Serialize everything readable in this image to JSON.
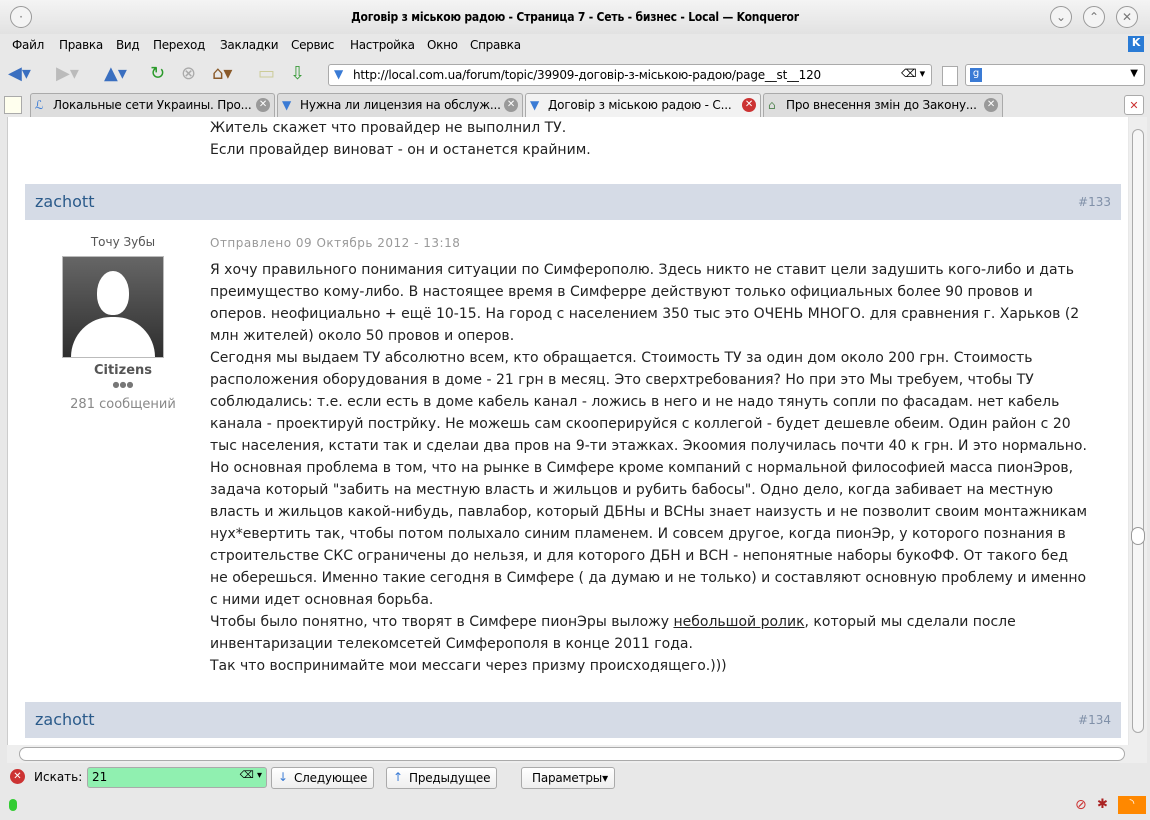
{
  "window": {
    "title": "Договір з міською радою - Страница 7 - Сеть - бизнес - Local — Konqueror"
  },
  "menu": [
    "Файл",
    "Правка",
    "Вид",
    "Переход",
    "Закладки",
    "Сервис",
    "Настройка",
    "Окно",
    "Справка"
  ],
  "url": "http://local.com.ua/forum/topic/39909-договір-з-міською-радою/page__st__120",
  "tabs": [
    {
      "label": "Локальные сети Украины. Про..."
    },
    {
      "label": "Нужна ли лицензия на обслуж..."
    },
    {
      "label": "Договір з міською радою - С..."
    },
    {
      "label": "Про внесення змін до Закону..."
    }
  ],
  "prev_post": {
    "lines": [
      "Житель скажет что провайдер не выполнил ТУ.",
      "Если провайдер виноват - он и останется крайним."
    ]
  },
  "post": {
    "author": "zachott",
    "number": "#133",
    "user_title": "Точу Зубы",
    "group": "Citizens",
    "pips": "●●●",
    "post_count": "281 сообщений",
    "date": "Отправлено 09 Октябрь 2012 - 13:18",
    "lines": [
      "Я хочу правильного понимания ситуации по Симферополю. Здесь никто не ставит цели задушить кого-либо и дать",
      "преимущество кому-либо. В настоящее время в Симферре действуют только официальных более 90 провов и",
      "оперов. неофициально + ещё 10-15. На город с населением 350 тыс это ОЧЕНЬ МНОГО. для сравнения г. Харьков (2",
      "млн жителей) около 50 провов и оперов.",
      "Сегодня мы выдаем ТУ абсолютно всем, кто обращается. Стоимость ТУ за один дом около 200 грн. Стоимость",
      "расположения оборудования в доме - 21 грн в месяц. Это сверхтребования? Но при это Мы требуем, чтобы ТУ",
      "соблюдались: т.е. если есть в доме кабель канал - ложись в него и не надо тянуть сопли по фасадам. нет кабель",
      "канала - проектируй пострйку. Не можешь сам скооперируйся с коллегой - будет дешевле обеим. Один район с 20",
      "тыс населения, кстати так и сделаи два пров на 9-ти этажках. Экоомия получилась почти 40 к грн. И это нормально.",
      "Но основная проблема в том, что на рынке в Симфере кроме компаний с нормальной философией масса пионЭров,",
      "задача который \"забить на местную власть и жильцов и рубить бабосы\". Одно дело, когда забивает на местную",
      "власть и жильцов какой-нибудь, павлабор, который ДБНы и ВСНы знает наизусть и не позволит своим монтажникам",
      "нух*евертить так, чтобы потом полыхало синим пламенем. И совсем другое, когда пионЭр, у которого познания в",
      "строительстве СКС ограничены до нельзя, и для которого ДБН и ВСН - непонятные наборы букоФФ. От такого бед",
      "не оберешься. Именно такие сегодня в Симфере ( да думаю и не только) и составляют основную проблему и именно",
      "с ними идет основная борьба."
    ],
    "link_line": {
      "before": "Чтобы было понятно, что творят в Симфере пионЭры выложу ",
      "link": "небольшой ролик",
      "after": ", который мы сделали после"
    },
    "tail_lines": [
      "инвентаризации телекомсетей Симферополя в конце 2011 года.",
      "Так что воспринимайте мои мессаги через призму происходящего.)))"
    ]
  },
  "next_post": {
    "author": "zachott",
    "number": "#134"
  },
  "find": {
    "label": "Искать:",
    "value": "21",
    "next": "Следующее",
    "prev": "Предыдущее",
    "options": "Параметры"
  },
  "colors": {
    "post_header": "#d5dbe6",
    "find_ok": "#90f0b0"
  }
}
